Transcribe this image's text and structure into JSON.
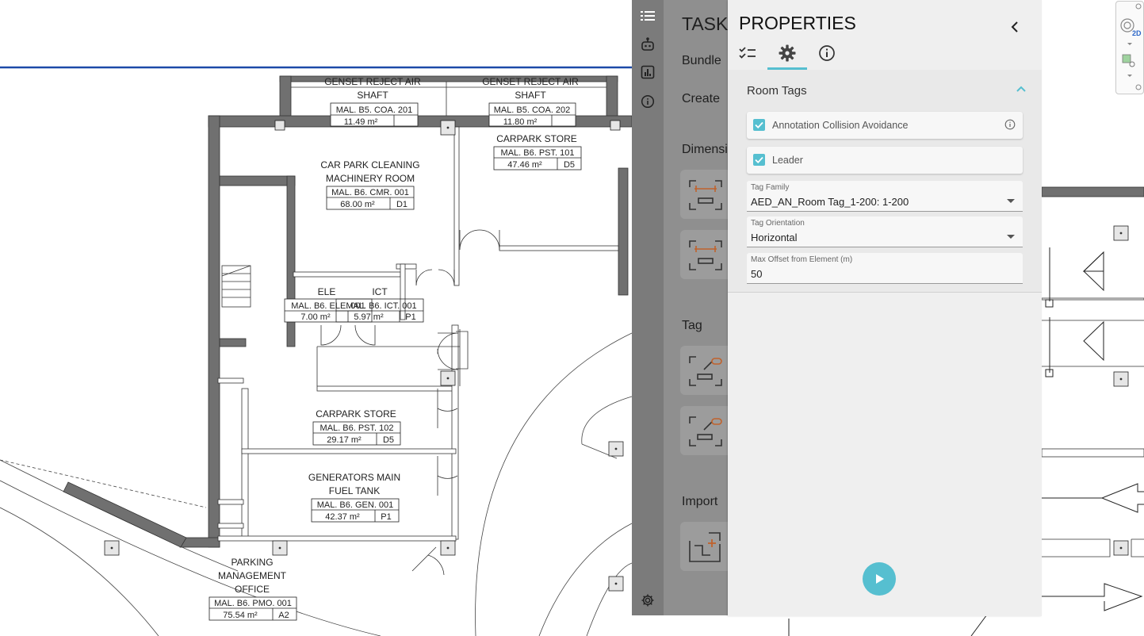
{
  "floor_plan": {
    "rooms": [
      {
        "name_lines": [
          "GENSET REJECT AIR",
          "SHAFT"
        ],
        "code": "MAL. B5. COA. 201",
        "area": "11.49 m²",
        "tag": ""
      },
      {
        "name_lines": [
          "GENSET REJECT AIR",
          "SHAFT"
        ],
        "code": "MAL. B5. COA. 202",
        "area": "11.80 m²",
        "tag": ""
      },
      {
        "name_lines": [
          "CARPARK STORE"
        ],
        "code": "MAL. B6. PST. 101",
        "area": "47.46 m²",
        "tag": "D5"
      },
      {
        "name_lines": [
          "CAR PARK CLEANING",
          "MACHINERY ROOM"
        ],
        "code": "MAL. B6. CMR. 001",
        "area": "68.00 m²",
        "tag": "D1"
      },
      {
        "name_lines": [
          "ELE"
        ],
        "code": "MAL. B6. ELE. 001",
        "area": "7.00 m²",
        "tag": ""
      },
      {
        "name_lines": [
          "ICT"
        ],
        "code": "MAL. B6. ICT. 001",
        "area": "5.97 m²",
        "tag": "P1"
      },
      {
        "name_lines": [
          "CARPARK STORE"
        ],
        "code": "MAL. B6. PST. 102",
        "area": "29.17 m²",
        "tag": "D5"
      },
      {
        "name_lines": [
          "GENERATORS MAIN",
          "FUEL TANK"
        ],
        "code": "MAL. B6. GEN. 001",
        "area": "42.37 m²",
        "tag": "P1"
      },
      {
        "name_lines": [
          "PARKING",
          "MANAGEMENT",
          "OFFICE"
        ],
        "code": "MAL. B6. PMO. 001",
        "area": "75.54 m²",
        "tag": "A2"
      }
    ]
  },
  "rail": {
    "icons": [
      "list-icon",
      "robot-icon",
      "chart-icon",
      "info-icon"
    ],
    "bottom_icon": "settings-icon"
  },
  "tasks_panel": {
    "title": "TASKS",
    "items": {
      "bundle": "Bundle",
      "create": "Create",
      "dimensions": "Dimensions",
      "tag": "Tag",
      "import": "Import"
    }
  },
  "properties": {
    "title": "PROPERTIES",
    "tabs": [
      {
        "icon": "checklist-icon",
        "active": false
      },
      {
        "icon": "gear-icon",
        "active": true
      },
      {
        "icon": "info-icon",
        "active": false
      }
    ],
    "section_title": "Room Tags",
    "checkboxes": [
      {
        "label": "Annotation Collision Avoidance",
        "checked": true
      },
      {
        "label": "Leader",
        "checked": true
      }
    ],
    "fields": [
      {
        "label": "Tag Family",
        "value": "AED_AN_Room Tag_1-200: 1-200"
      },
      {
        "label": "Tag Orientation",
        "value": "Horizontal"
      },
      {
        "label": "Max Offset from Element (m)",
        "value": "50"
      }
    ],
    "accent_color": "#56bfd0"
  },
  "navcube": {
    "label": "2D"
  }
}
